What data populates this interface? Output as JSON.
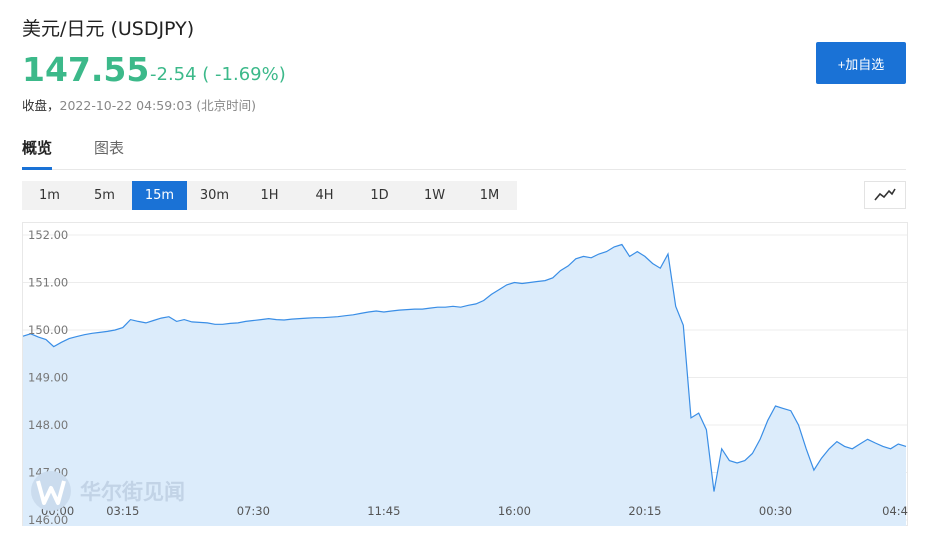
{
  "header": {
    "title": "美元/日元  (USDJPY)",
    "price": "147.55",
    "change": "-2.54 ( -1.69%)",
    "status_label": "收盘，",
    "timestamp": "2022-10-22 04:59:03 (北京时间)"
  },
  "actions": {
    "add_watchlist": "+加自选"
  },
  "tabs": [
    {
      "label": "概览",
      "active": true
    },
    {
      "label": "图表",
      "active": false
    }
  ],
  "periods": [
    {
      "label": "1m"
    },
    {
      "label": "5m"
    },
    {
      "label": "15m",
      "active": true
    },
    {
      "label": "30m"
    },
    {
      "label": "1H"
    },
    {
      "label": "4H"
    },
    {
      "label": "1D"
    },
    {
      "label": "1W"
    },
    {
      "label": "1M"
    }
  ],
  "icons": {
    "chart_toggle": "line-chart-icon",
    "watermark": "wallstreetcn-logo-icon"
  },
  "watermark": {
    "text": "华尔街见闻"
  },
  "colors": {
    "up_down": "#3cb98a",
    "accent": "#1a72d6",
    "area_fill": "#dcecfb",
    "line": "#3a8ee6"
  },
  "chart_data": {
    "type": "area",
    "ylim": [
      146.7,
      152.25
    ],
    "yticks": [
      "152.00",
      "151.00",
      "150.00",
      "149.00",
      "148.00",
      "147.00",
      "146.00"
    ],
    "xticks": [
      {
        "t": 0,
        "label": "00:00"
      },
      {
        "t": 13,
        "label": "03:15"
      },
      {
        "t": 30,
        "label": "07:30"
      },
      {
        "t": 47,
        "label": "11:45"
      },
      {
        "t": 64,
        "label": "16:00"
      },
      {
        "t": 81,
        "label": "20:15"
      },
      {
        "t": 98,
        "label": "00:30"
      },
      {
        "t": 115,
        "label": "04:4"
      }
    ],
    "x": [
      0,
      1,
      2,
      3,
      4,
      5,
      6,
      7,
      8,
      9,
      10,
      11,
      12,
      13,
      14,
      15,
      16,
      17,
      18,
      19,
      20,
      21,
      22,
      23,
      24,
      25,
      26,
      27,
      28,
      29,
      30,
      31,
      32,
      33,
      34,
      35,
      36,
      37,
      38,
      39,
      40,
      41,
      42,
      43,
      44,
      45,
      46,
      47,
      48,
      49,
      50,
      51,
      52,
      53,
      54,
      55,
      56,
      57,
      58,
      59,
      60,
      61,
      62,
      63,
      64,
      65,
      66,
      67,
      68,
      69,
      70,
      71,
      72,
      73,
      74,
      75,
      76,
      77,
      78,
      79,
      80,
      81,
      82,
      83,
      84,
      85,
      86,
      87,
      88,
      89,
      90,
      91,
      92,
      93,
      94,
      95,
      96,
      97,
      98,
      99,
      100,
      101,
      102,
      103,
      104,
      105,
      106,
      107,
      108,
      109,
      110,
      111,
      112,
      113,
      114,
      115
    ],
    "values": [
      149.87,
      149.92,
      149.85,
      149.8,
      149.65,
      149.74,
      149.82,
      149.86,
      149.9,
      149.93,
      149.95,
      149.97,
      150.0,
      150.05,
      150.22,
      150.18,
      150.15,
      150.2,
      150.25,
      150.28,
      150.18,
      150.22,
      150.17,
      150.16,
      150.15,
      150.12,
      150.12,
      150.14,
      150.15,
      150.18,
      150.2,
      150.22,
      150.24,
      150.22,
      150.21,
      150.23,
      150.24,
      150.25,
      150.26,
      150.26,
      150.27,
      150.28,
      150.3,
      150.32,
      150.35,
      150.38,
      150.4,
      150.38,
      150.4,
      150.42,
      150.43,
      150.44,
      150.44,
      150.46,
      150.48,
      150.48,
      150.5,
      150.48,
      150.52,
      150.55,
      150.62,
      150.75,
      150.85,
      150.95,
      151.0,
      150.98,
      151.0,
      151.02,
      151.04,
      151.1,
      151.25,
      151.35,
      151.5,
      151.55,
      151.52,
      151.6,
      151.65,
      151.75,
      151.8,
      151.55,
      151.65,
      151.55,
      151.4,
      151.3,
      151.6,
      150.5,
      150.1,
      148.15,
      148.25,
      147.9,
      146.6,
      147.5,
      147.25,
      147.2,
      147.25,
      147.4,
      147.7,
      148.1,
      148.4,
      148.35,
      148.3,
      148.0,
      147.5,
      147.05,
      147.3,
      147.5,
      147.65,
      147.55,
      147.5,
      147.6,
      147.7,
      147.62,
      147.55,
      147.5,
      147.6,
      147.55
    ]
  }
}
